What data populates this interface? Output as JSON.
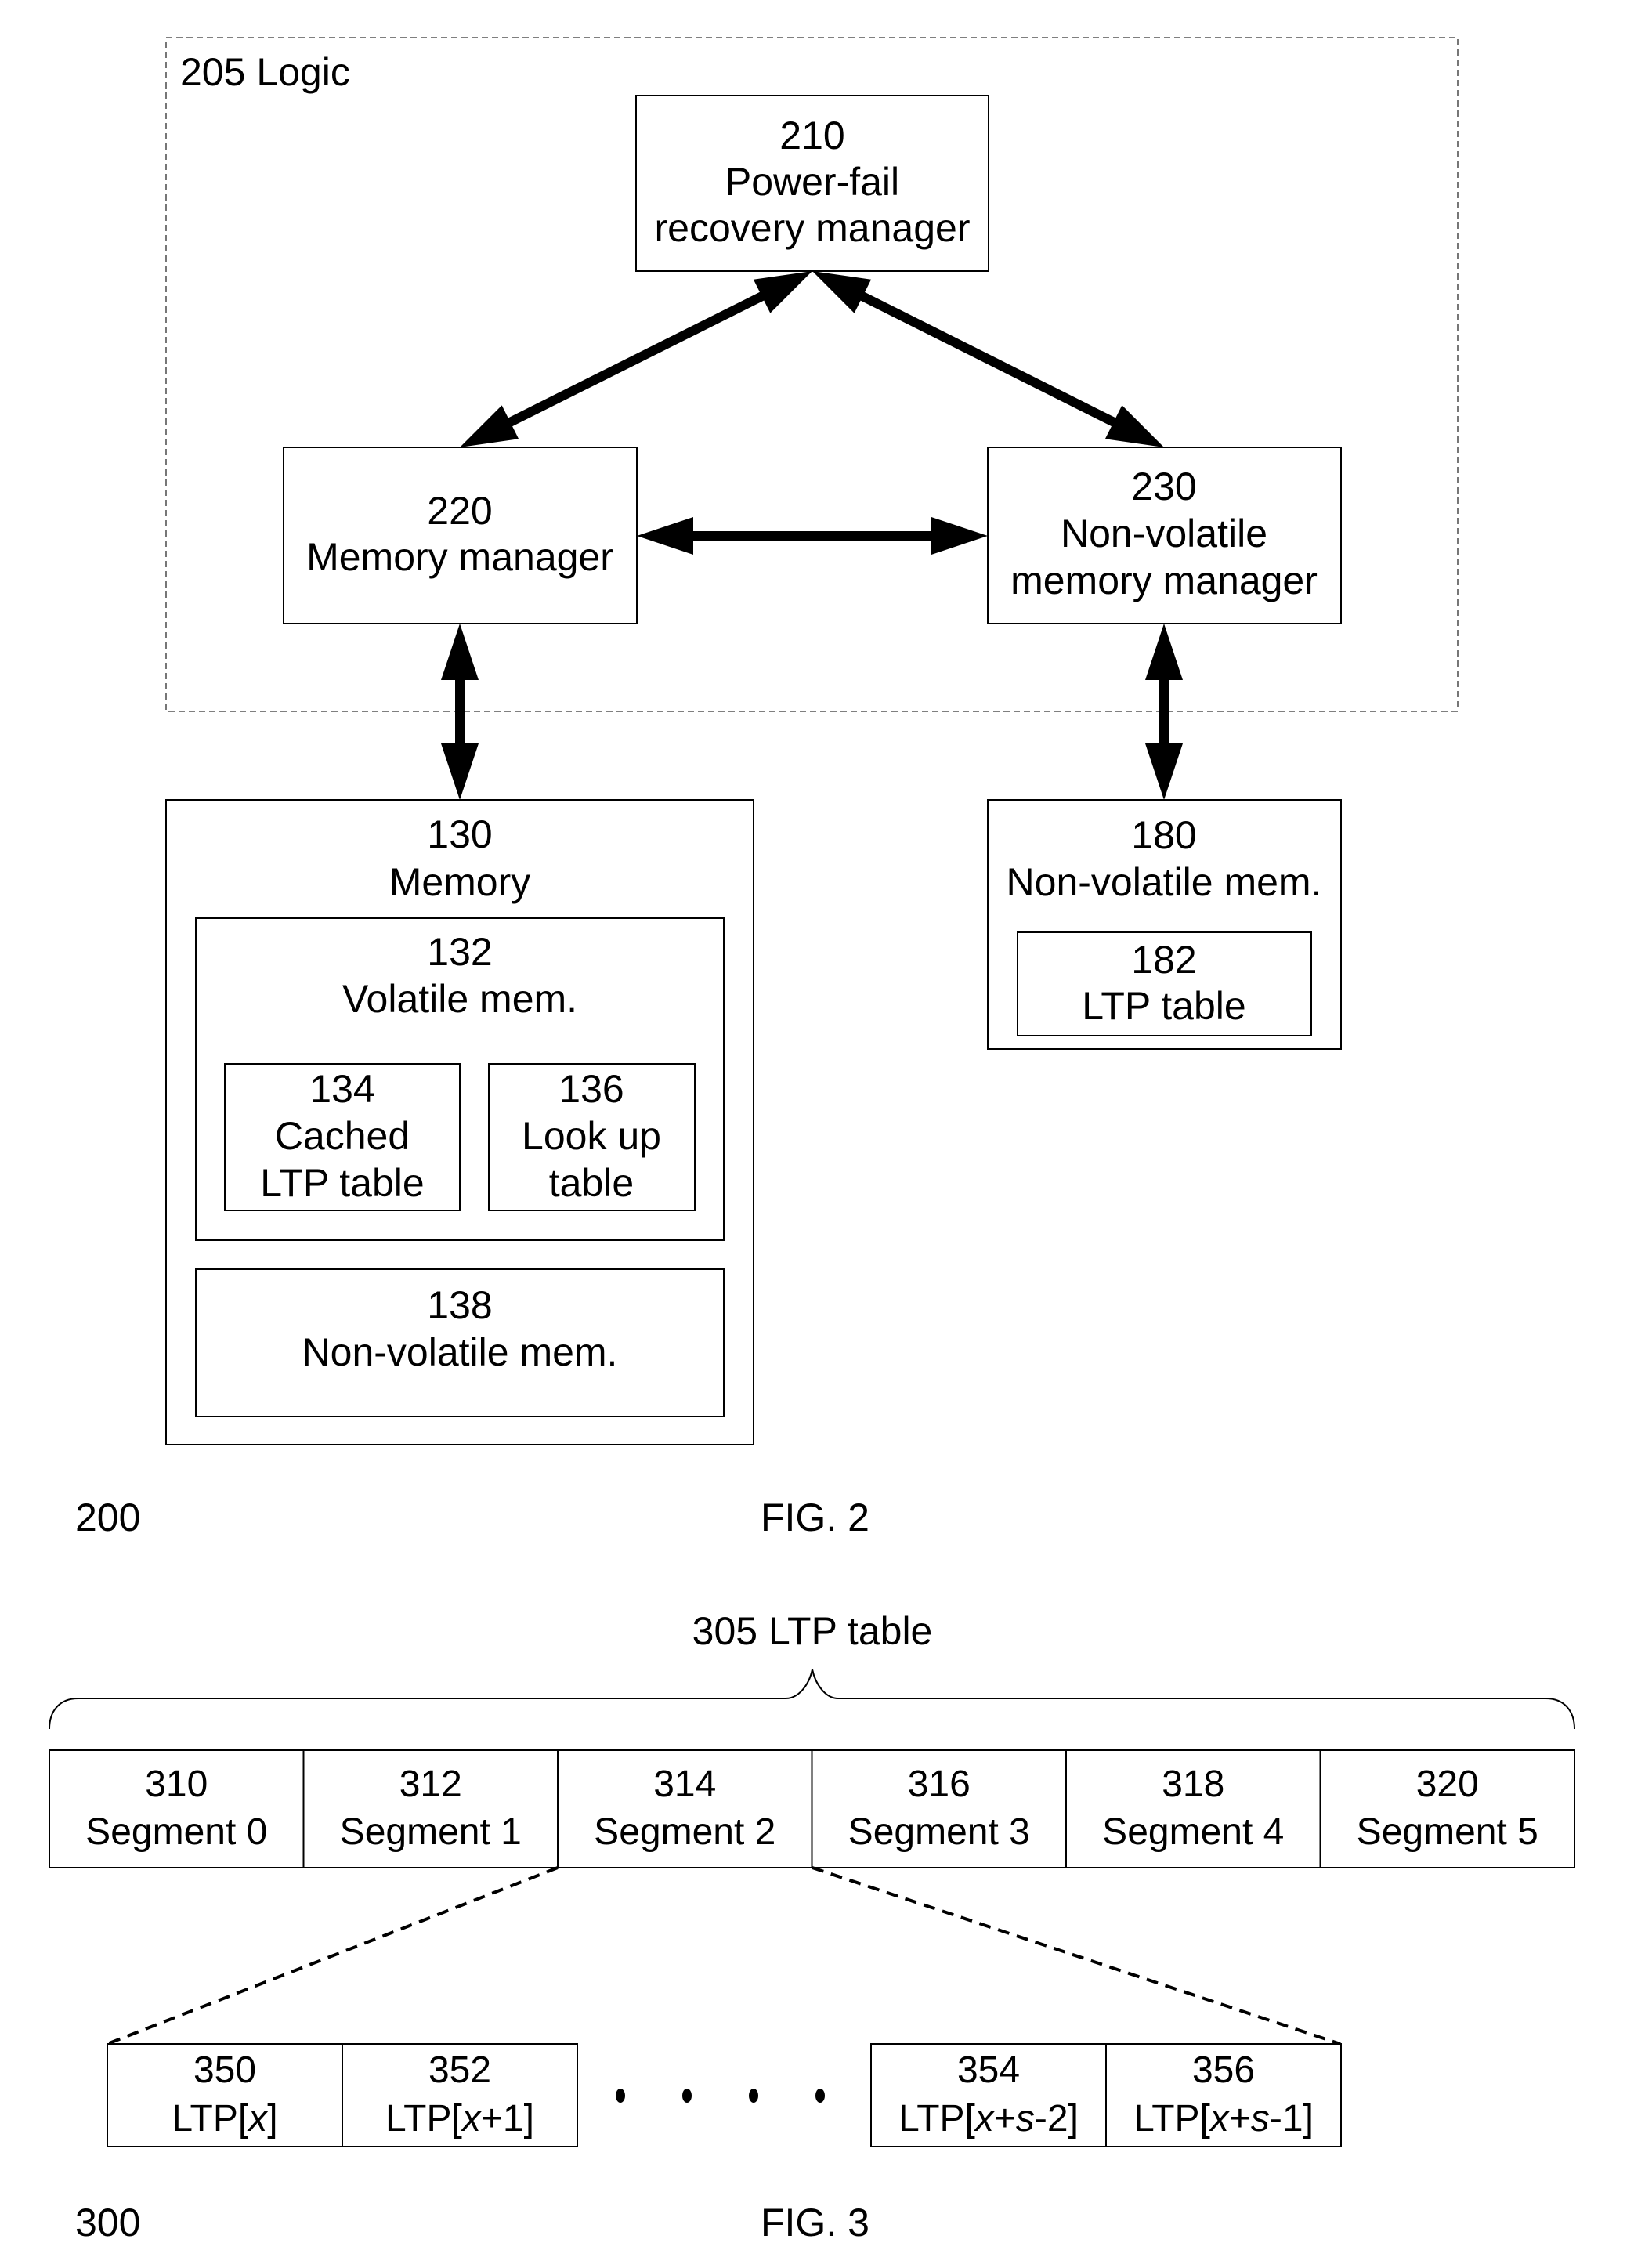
{
  "fig2": {
    "ref": "200",
    "caption": "FIG. 2",
    "logic": {
      "label": "205 Logic"
    },
    "power_fail": {
      "ref": "210",
      "line1": "Power-fail",
      "line2": "recovery manager"
    },
    "memory_manager": {
      "ref": "220",
      "line1": "Memory manager"
    },
    "nv_memory_manager": {
      "ref": "230",
      "line1": "Non-volatile",
      "line2": "memory manager"
    },
    "memory": {
      "ref": "130",
      "line1": "Memory",
      "volatile": {
        "ref": "132",
        "line1": "Volatile mem.",
        "cached_ltp": {
          "ref": "134",
          "line1": "Cached",
          "line2": "LTP table"
        },
        "lookup": {
          "ref": "136",
          "line1": "Look up",
          "line2": "table"
        }
      },
      "nonvolatile": {
        "ref": "138",
        "line1": "Non-volatile mem."
      }
    },
    "nv_mem": {
      "ref": "180",
      "line1": "Non-volatile mem.",
      "ltp_table": {
        "ref": "182",
        "line1": "LTP table"
      }
    },
    "connections": [
      {
        "from": "220",
        "to": "210",
        "type": "bidirectional"
      },
      {
        "from": "210",
        "to": "230",
        "type": "bidirectional"
      },
      {
        "from": "220",
        "to": "230",
        "type": "bidirectional"
      },
      {
        "from": "220",
        "to": "130",
        "type": "bidirectional"
      },
      {
        "from": "230",
        "to": "180",
        "type": "bidirectional"
      }
    ]
  },
  "fig3": {
    "ref": "300",
    "caption": "FIG. 3",
    "table_label": "305 LTP table",
    "segments": [
      {
        "ref": "310",
        "label": "Segment 0"
      },
      {
        "ref": "312",
        "label": "Segment 1"
      },
      {
        "ref": "314",
        "label": "Segment 2"
      },
      {
        "ref": "316",
        "label": "Segment 3"
      },
      {
        "ref": "318",
        "label": "Segment 4"
      },
      {
        "ref": "320",
        "label": "Segment 5"
      }
    ],
    "expanded_segment_index": 2,
    "entries": [
      {
        "ref": "350",
        "prefix": "LTP[",
        "var": "x",
        "suffix": "]",
        "expr": ""
      },
      {
        "ref": "352",
        "prefix": "LTP[",
        "var": "x",
        "suffix": "]",
        "expr": "+1"
      },
      {
        "ref": "354",
        "prefix": "LTP[",
        "var": "x",
        "suffix": "]",
        "expr": "+",
        "var2": "s",
        "expr2": "-2"
      },
      {
        "ref": "356",
        "prefix": "LTP[",
        "var": "x",
        "suffix": "]",
        "expr": "+",
        "var2": "s",
        "expr2": "-1"
      }
    ],
    "ellipsis": "• • • •"
  }
}
